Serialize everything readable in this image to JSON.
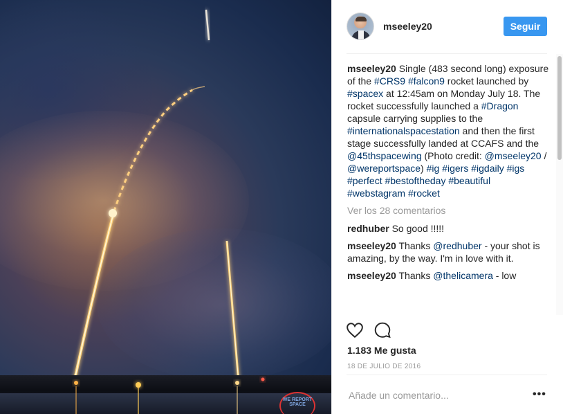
{
  "post": {
    "username": "mseeley20",
    "follow_label": "Seguir",
    "caption_segments": [
      {
        "text": "Single (483 second long) exposure of the ",
        "type": "text"
      },
      {
        "text": "#CRS9",
        "type": "tag"
      },
      {
        "text": " ",
        "type": "text"
      },
      {
        "text": "#falcon9",
        "type": "tag"
      },
      {
        "text": " rocket launched by ",
        "type": "text"
      },
      {
        "text": "#spacex",
        "type": "tag"
      },
      {
        "text": " at 12:45am on Monday July 18. The rocket successfully launched a ",
        "type": "text"
      },
      {
        "text": "#Dragon",
        "type": "tag"
      },
      {
        "text": " capsule carrying supplies to the ",
        "type": "text"
      },
      {
        "text": "#internationalspacestation",
        "type": "tag"
      },
      {
        "text": " and then the first stage successfully landed at CCAFS and the ",
        "type": "text"
      },
      {
        "text": "@45thspacewing",
        "type": "tag"
      },
      {
        "text": " (Photo credit: ",
        "type": "text"
      },
      {
        "text": "@mseeley20",
        "type": "tag"
      },
      {
        "text": " / ",
        "type": "text"
      },
      {
        "text": "@wereportspace",
        "type": "tag"
      },
      {
        "text": ") ",
        "type": "text"
      },
      {
        "text": "#ig",
        "type": "tag"
      },
      {
        "text": " ",
        "type": "text"
      },
      {
        "text": "#igers",
        "type": "tag"
      },
      {
        "text": " ",
        "type": "text"
      },
      {
        "text": "#igdaily",
        "type": "tag"
      },
      {
        "text": " ",
        "type": "text"
      },
      {
        "text": "#igs",
        "type": "tag"
      },
      {
        "text": " ",
        "type": "text"
      },
      {
        "text": "#perfect",
        "type": "tag"
      },
      {
        "text": " ",
        "type": "text"
      },
      {
        "text": "#bestoftheday",
        "type": "tag"
      },
      {
        "text": " ",
        "type": "text"
      },
      {
        "text": "#beautiful",
        "type": "tag"
      },
      {
        "text": " ",
        "type": "text"
      },
      {
        "text": "#webstagram",
        "type": "tag"
      },
      {
        "text": " ",
        "type": "text"
      },
      {
        "text": "#rocket",
        "type": "tag"
      }
    ],
    "view_more_label": "Ver los 28 comentarios",
    "comments": [
      {
        "user": "redhuber",
        "segments": [
          {
            "text": "So good !!!!!",
            "type": "text"
          }
        ]
      },
      {
        "user": "mseeley20",
        "segments": [
          {
            "text": "Thanks ",
            "type": "text"
          },
          {
            "text": "@redhuber",
            "type": "tag"
          },
          {
            "text": " - your shot is amazing, by the way. I'm in love with it.",
            "type": "text"
          }
        ]
      },
      {
        "user": "mseeley20",
        "segments": [
          {
            "text": "Thanks ",
            "type": "text"
          },
          {
            "text": "@thelicamera",
            "type": "tag"
          },
          {
            "text": " - low",
            "type": "text"
          }
        ]
      }
    ],
    "likes_label": "1.183 Me gusta",
    "date_label": "18 DE JULIO DE 2016",
    "add_comment_placeholder": "Añade un comentario...",
    "more_options_label": "•••",
    "watermark_text": "WE REPORT SPACE"
  },
  "icons": {
    "like": "heart-icon",
    "comment": "comment-bubble-icon",
    "more": "ellipsis-icon"
  },
  "colors": {
    "follow_button": "#3897f0",
    "hashtag": "#003569",
    "muted": "#999999"
  }
}
